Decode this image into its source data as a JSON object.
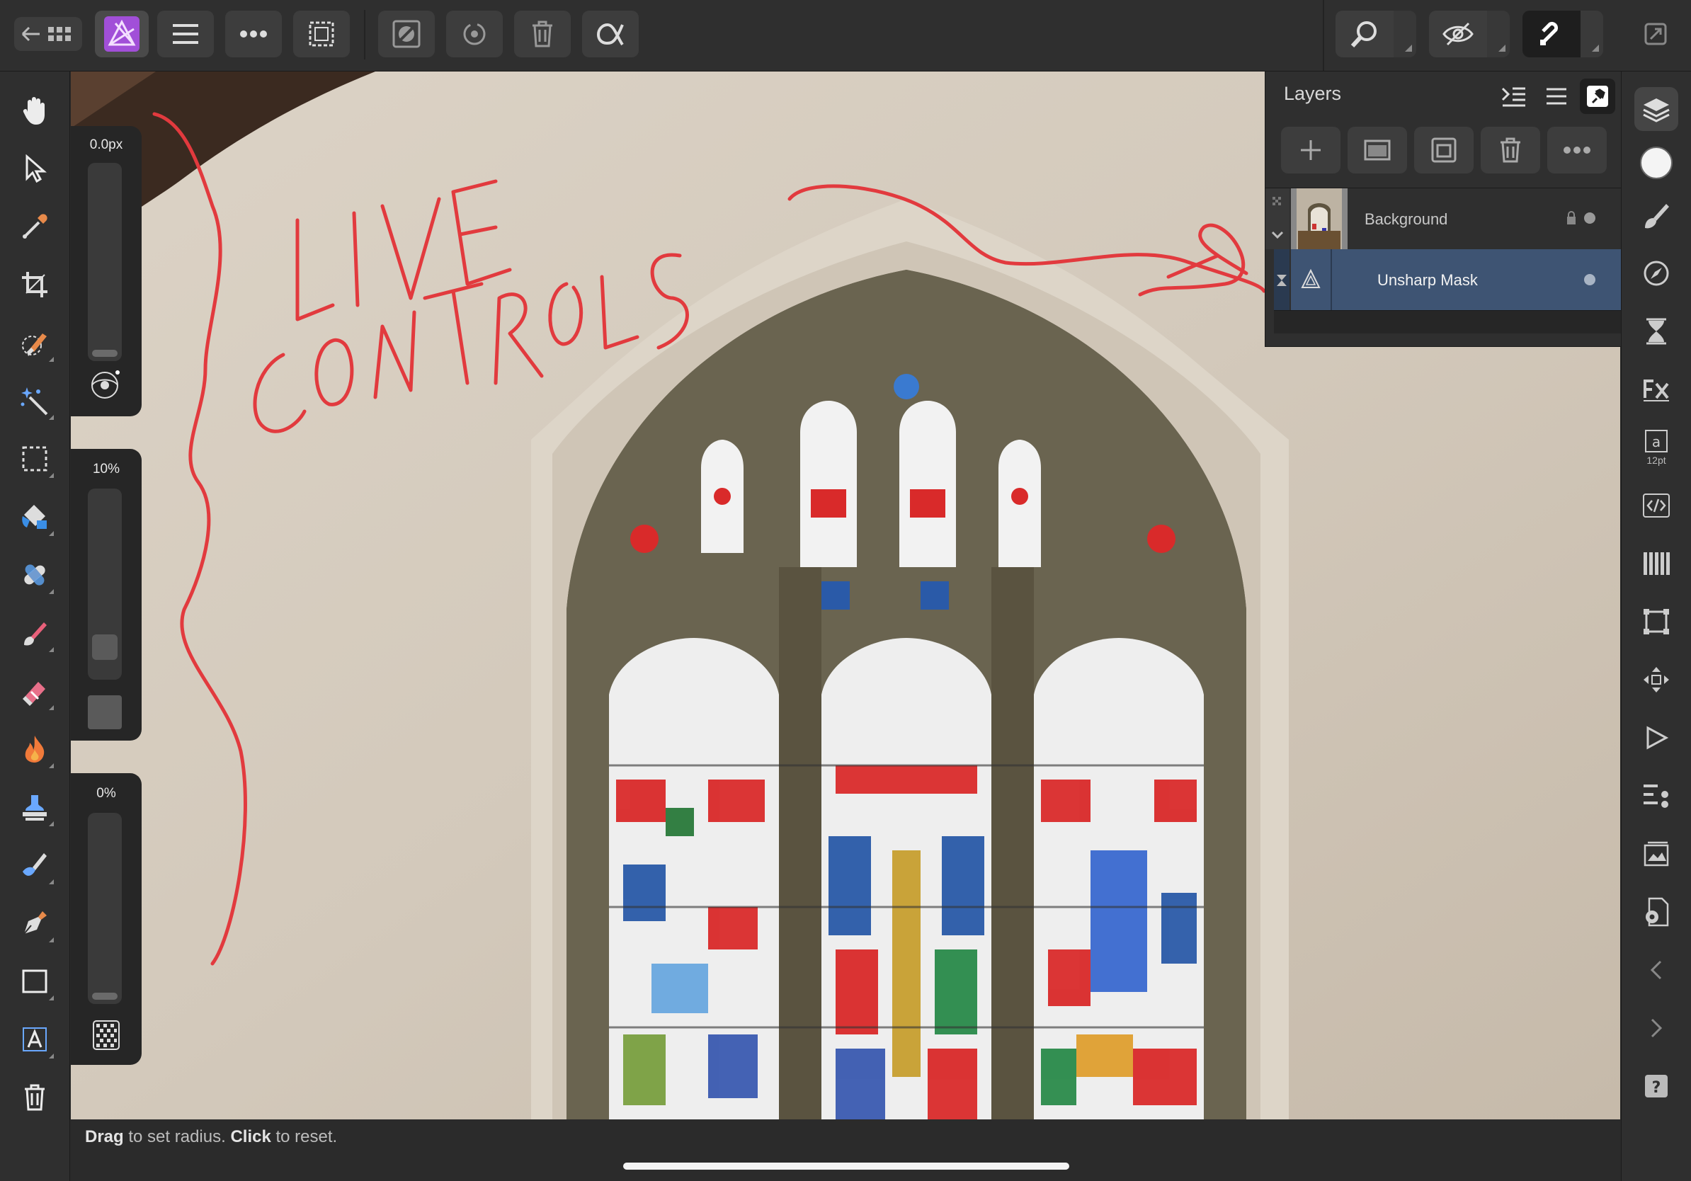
{
  "toolbar": {
    "back_icon": "back-arrow-grid-icon",
    "app_icon": "affinity-photo-persona-icon",
    "menu_icon": "hamburger-icon",
    "more_icon": "more-dots-icon",
    "selection_icon": "marquee-selection-icon",
    "quick_mask_icon": "quick-mask-icon",
    "history_icon": "history-icon",
    "delete_icon": "trash-icon",
    "alpha_icon": "alpha-icon",
    "zoom_icon": "zoom-icon",
    "view_icon": "view-eye-icon",
    "snapping_icon": "snapping-magnet-icon",
    "fullscreen_icon": "window-toggle-icon"
  },
  "left_tools": [
    {
      "name": "hand-tool",
      "icon": "hand-icon"
    },
    {
      "name": "move-tool",
      "icon": "pointer-icon"
    },
    {
      "name": "color-picker-tool",
      "icon": "eyedropper-icon"
    },
    {
      "name": "crop-tool",
      "icon": "crop-icon"
    },
    {
      "name": "selection-brush-tool",
      "icon": "selection-brush-icon"
    },
    {
      "name": "flood-select-tool",
      "icon": "magic-wand-icon"
    },
    {
      "name": "marquee-tool",
      "icon": "rect-marquee-icon"
    },
    {
      "name": "flood-fill-tool",
      "icon": "paint-bucket-icon"
    },
    {
      "name": "healing-tool",
      "icon": "bandage-icon"
    },
    {
      "name": "paint-brush-tool",
      "icon": "brush-icon"
    },
    {
      "name": "erase-brush-tool",
      "icon": "eraser-icon"
    },
    {
      "name": "burn-tool",
      "icon": "flame-icon"
    },
    {
      "name": "clone-tool",
      "icon": "stamp-icon"
    },
    {
      "name": "smudge-tool",
      "icon": "smudge-icon"
    },
    {
      "name": "pen-tool",
      "icon": "pen-icon"
    },
    {
      "name": "shape-tool",
      "icon": "rectangle-icon"
    },
    {
      "name": "text-tool",
      "icon": "text-icon"
    },
    {
      "name": "delete-tool",
      "icon": "trash-icon"
    }
  ],
  "context": {
    "radius_value": "0.0px",
    "factor_value": "10%",
    "threshold_value": "0%",
    "radius_level": 0,
    "factor_level": 0.1,
    "threshold_level": 0
  },
  "status": {
    "drag_word": "Drag",
    "drag_text": "to set radius.",
    "click_word": "Click",
    "click_text": "to reset."
  },
  "annotation": {
    "line1": "LIVE",
    "line2": "CONTROLS"
  },
  "layers_panel": {
    "title": "Layers",
    "buttons": [
      "add-layer-icon",
      "mask-layer-icon",
      "group-layer-icon",
      "delete-layer-icon",
      "more-dots-icon"
    ],
    "layers": [
      {
        "name": "Background",
        "locked": true,
        "visible": true,
        "selected": false
      },
      {
        "name": "Unsharp Mask",
        "locked": false,
        "visible": true,
        "selected": true
      }
    ]
  },
  "studio_tools": [
    {
      "name": "layers-studio",
      "icon": "layers-stack-icon",
      "active": true
    },
    {
      "name": "color-studio",
      "icon": "color-swatch-icon"
    },
    {
      "name": "brushes-studio",
      "icon": "brush-icon"
    },
    {
      "name": "navigator-studio",
      "icon": "compass-icon"
    },
    {
      "name": "history-studio",
      "icon": "hourglass-icon"
    },
    {
      "name": "fx-studio",
      "icon": "fx-icon"
    },
    {
      "name": "character-studio",
      "icon": "character-icon",
      "label": "12pt"
    },
    {
      "name": "source-studio",
      "icon": "code-icon"
    },
    {
      "name": "channels-studio",
      "icon": "channels-icon"
    },
    {
      "name": "transform-studio",
      "icon": "transform-icon"
    },
    {
      "name": "move-studio",
      "icon": "move-arrows-icon"
    },
    {
      "name": "macro-studio",
      "icon": "play-icon"
    },
    {
      "name": "adjustments-studio",
      "icon": "adjust-list-icon"
    },
    {
      "name": "stock-studio",
      "icon": "image-stack-icon"
    },
    {
      "name": "settings-studio",
      "icon": "doc-gear-icon"
    },
    {
      "name": "collapse-left",
      "icon": "chevron-left-icon"
    },
    {
      "name": "collapse-right",
      "icon": "chevron-right-icon"
    },
    {
      "name": "help",
      "icon": "help-icon"
    }
  ],
  "colors": {
    "annotation_red": "#e23a3e",
    "selected_layer": "#3e5473",
    "app_icon_purple": "#a14fd8"
  }
}
